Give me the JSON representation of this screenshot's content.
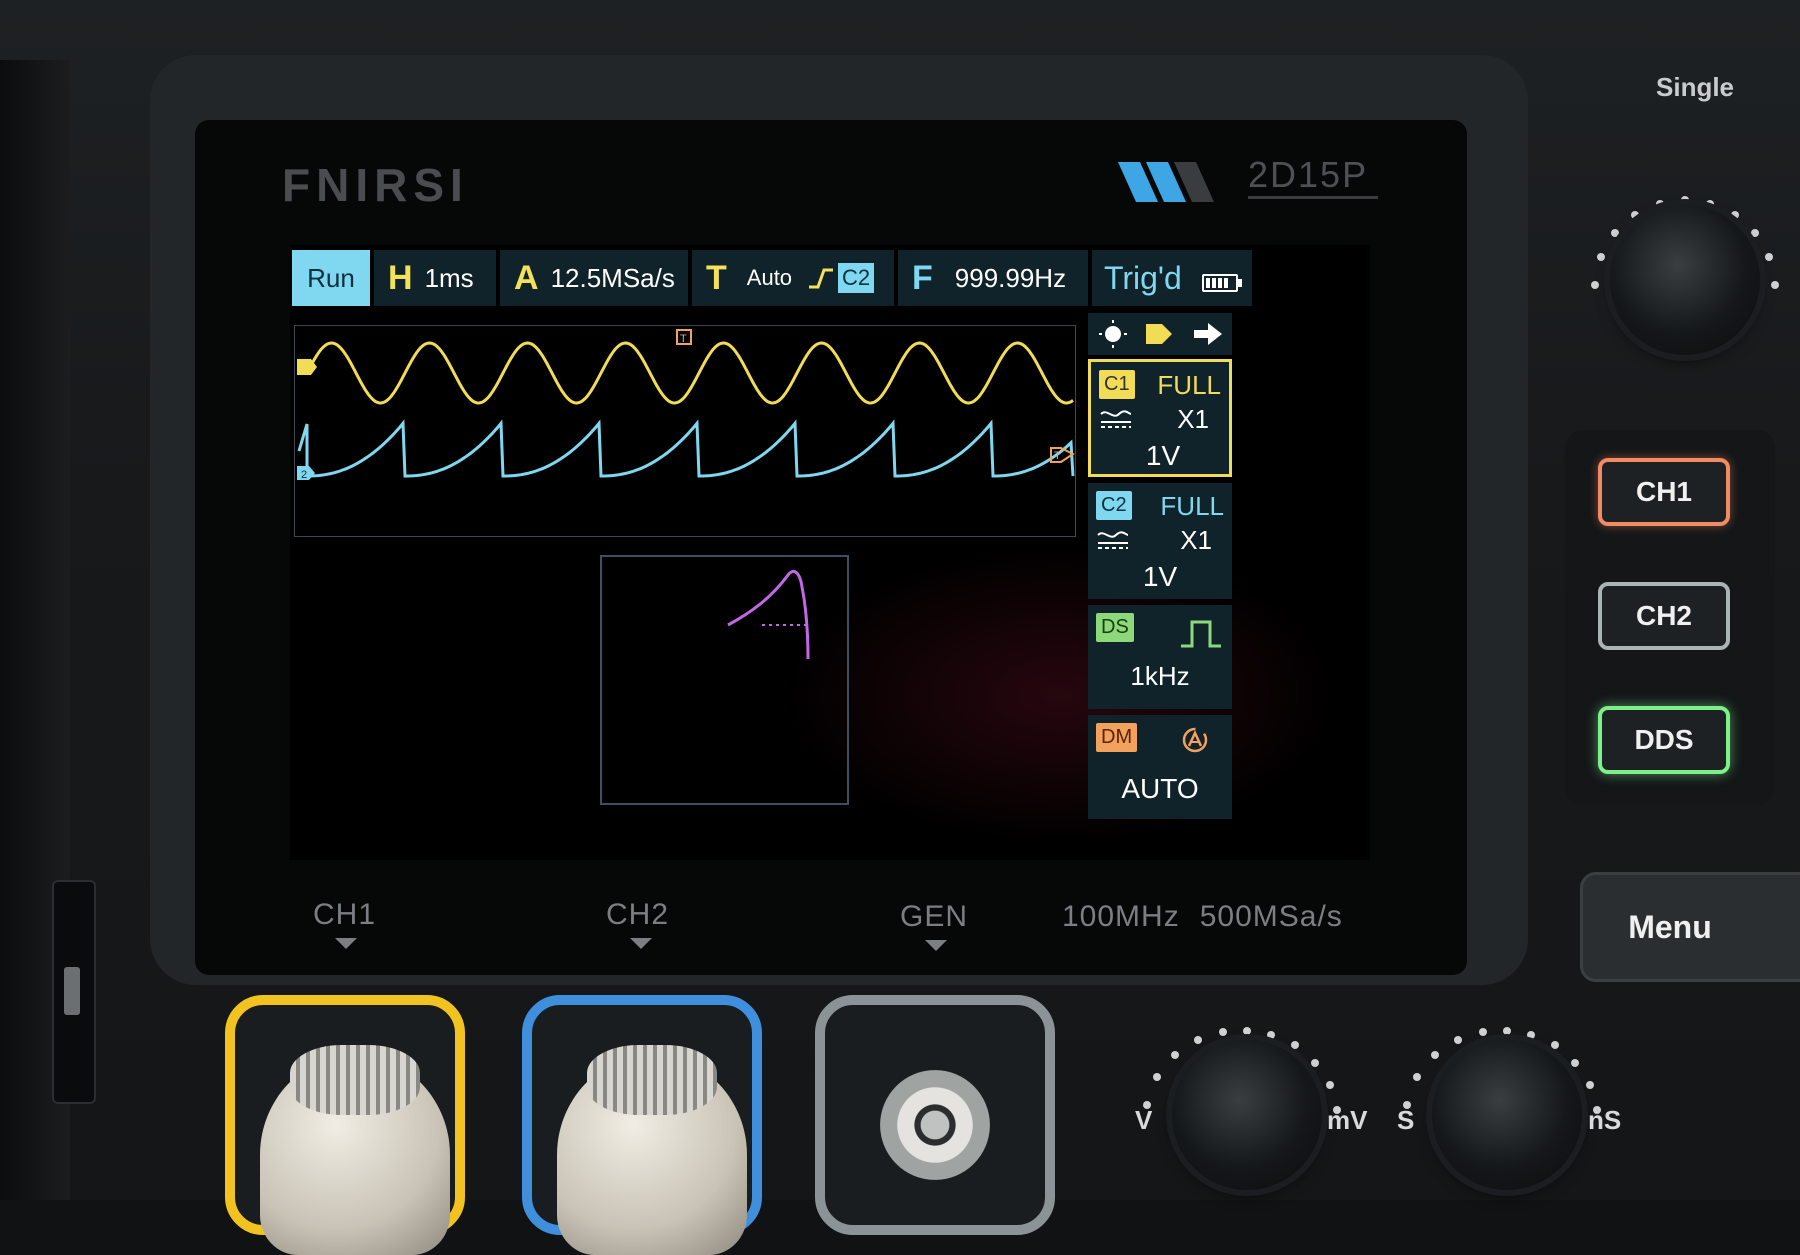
{
  "device": {
    "brand": "FNIRSI",
    "model": "2D15P",
    "specs": {
      "bandwidth": "100MHz",
      "sample_rate": "500MSa/s"
    },
    "single_label": "Single"
  },
  "status_bar": {
    "run_state": "Run",
    "horizontal": {
      "key": "H",
      "value": "1ms"
    },
    "acquisition": {
      "key": "A",
      "value": "12.5MSa/s"
    },
    "trigger": {
      "key": "T",
      "mode": "Auto",
      "source": "C2"
    },
    "frequency": {
      "key": "F",
      "value": "999.99Hz"
    },
    "trigger_status": "Trig'd"
  },
  "channels": [
    {
      "badge": "C1",
      "mode": "FULL",
      "probe": "X1",
      "volts_div": "1V",
      "color": "#f2dc55"
    },
    {
      "badge": "C2",
      "mode": "FULL",
      "probe": "X1",
      "volts_div": "1V",
      "color": "#7fd8ef"
    }
  ],
  "generator_card": {
    "badge": "DS",
    "frequency": "1kHz",
    "color": "#8ed87c"
  },
  "measure_card": {
    "badge": "DM",
    "mode": "AUTO",
    "color": "#f3a25e"
  },
  "input_labels": {
    "ch1": "CH1",
    "ch2": "CH2",
    "gen": "GEN"
  },
  "buttons": {
    "ch1": "CH1",
    "ch2": "CH2",
    "dds": "DDS",
    "menu": "Menu"
  },
  "knob_labels": {
    "volts": {
      "left": "V",
      "right": "mV"
    },
    "time": {
      "left": "S",
      "right": "nS"
    }
  },
  "trace_colors": {
    "ch1": "#f2dc55",
    "ch2": "#7fd8ef",
    "xy": "#c268e6"
  },
  "icons": [
    "brightness-icon",
    "tag-icon",
    "arrow-right-icon",
    "battery-icon",
    "coupling-icon",
    "square-wave-icon",
    "auto-icon",
    "trigger-edge-icon"
  ]
}
